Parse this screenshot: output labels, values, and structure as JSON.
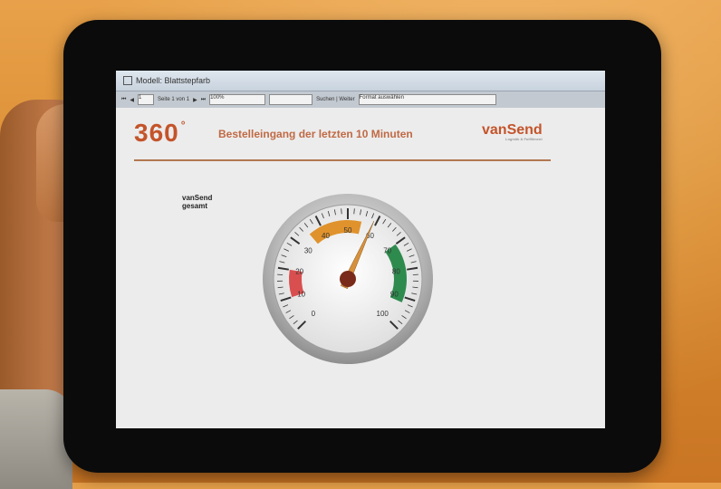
{
  "window": {
    "title": "Modell: Blattstepfarb"
  },
  "toolbar": {
    "page_current": "1",
    "page_label": "Seite 1 von 1",
    "zoom": "100%",
    "search_hint": "Suchen | Weiter",
    "format_select": "Format auswählen"
  },
  "report": {
    "logo_text": "360",
    "logo_sup": "°",
    "title": "Bestelleingang der letzten 10 Minuten",
    "brand_name": "vanSend",
    "brand_tagline": "Logistik & Fulfillment"
  },
  "gauge": {
    "label_line1": "vanSend",
    "label_line2": "gesamt",
    "value": 59,
    "min": 0,
    "max": 100,
    "ticks": [
      "0",
      "10",
      "20",
      "30",
      "40",
      "50",
      "60",
      "70",
      "80",
      "90",
      "100"
    ],
    "bands": [
      {
        "from": 10,
        "to": 20,
        "color": "#d94f4f"
      },
      {
        "from": 35,
        "to": 55,
        "color": "#e0922c"
      },
      {
        "from": 70,
        "to": 92,
        "color": "#2e8b4e"
      }
    ],
    "needle_color": "#d7903c",
    "hub_color": "#7a2a1a"
  }
}
